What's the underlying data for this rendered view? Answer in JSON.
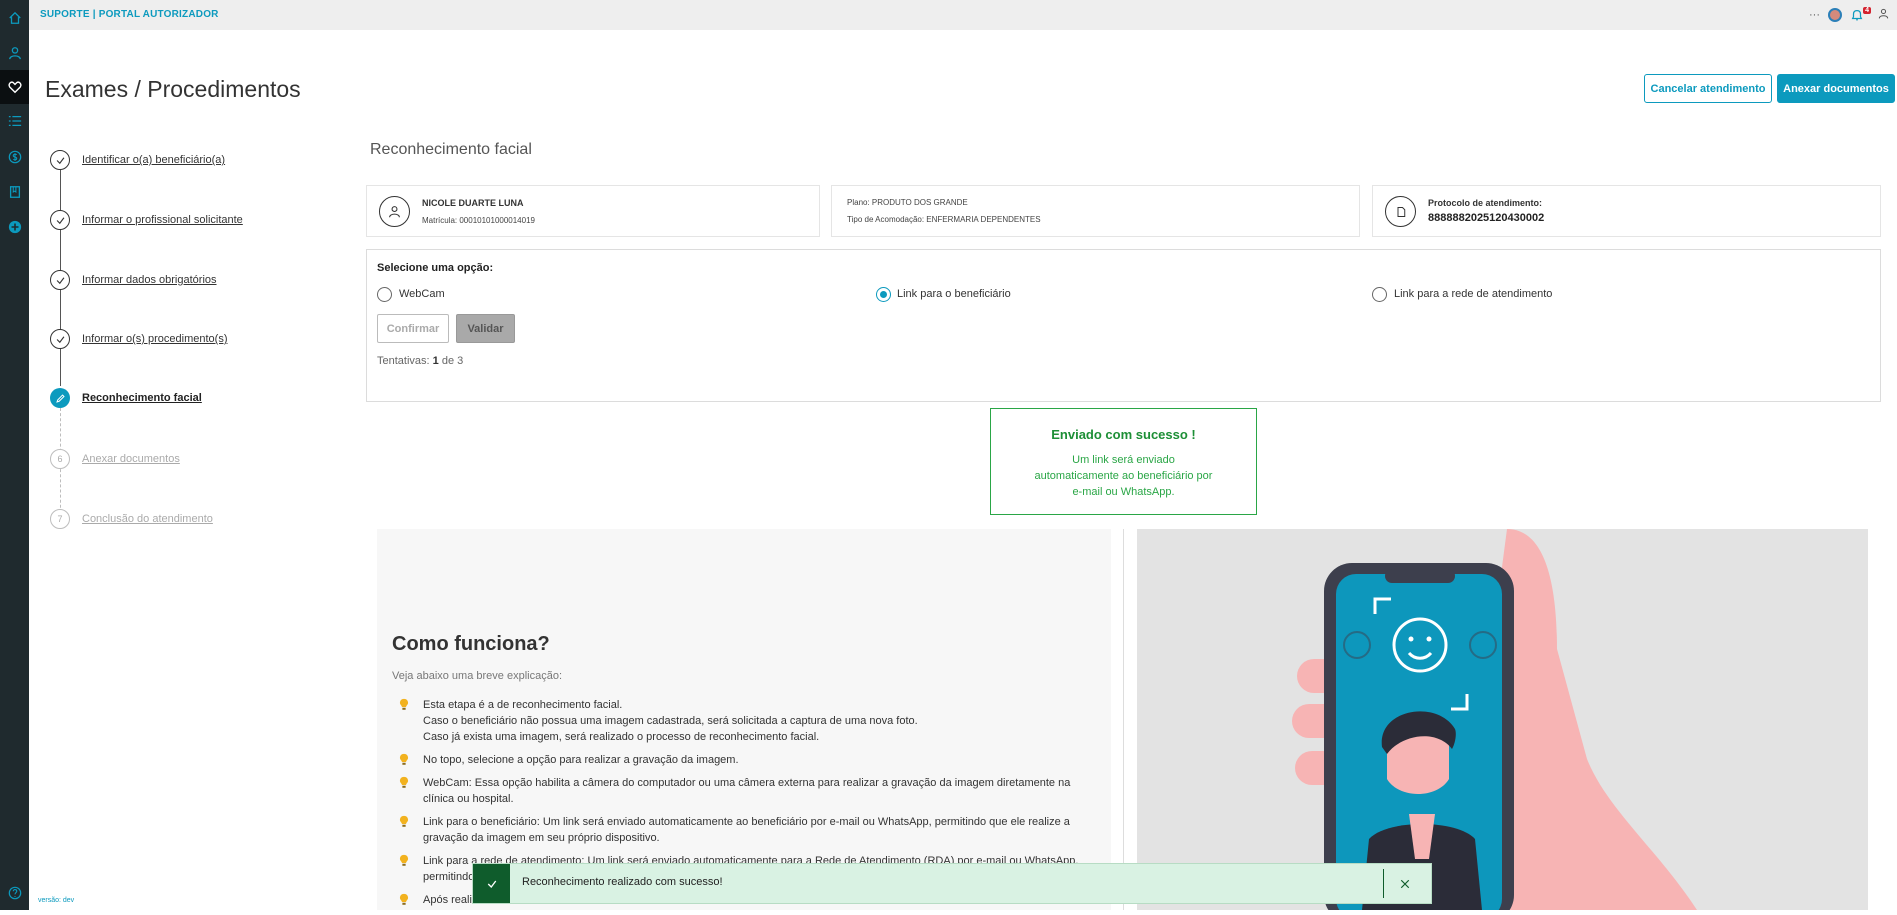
{
  "topbar": {
    "brand": "SUPORTE | PORTAL AUTORIZADOR",
    "more": "···",
    "notif_count": "4"
  },
  "page": {
    "title": "Exames / Procedimentos",
    "version": "versão: dev"
  },
  "buttons": {
    "cancel": "Cancelar atendimento",
    "attach": "Anexar documentos"
  },
  "steps": [
    {
      "label": "Identificar o(a) beneficiário(a)",
      "state": "done"
    },
    {
      "label": "Informar o profissional solicitante",
      "state": "done"
    },
    {
      "label": "Informar dados obrigatórios",
      "state": "done"
    },
    {
      "label": "Informar o(s) procedimento(s)",
      "state": "done"
    },
    {
      "label": "Reconhecimento facial",
      "state": "active"
    },
    {
      "label": "Anexar documentos",
      "state": "pending",
      "num": "6"
    },
    {
      "label": "Conclusão do atendimento",
      "state": "pending",
      "num": "7"
    }
  ],
  "section": {
    "title": "Reconhecimento facial"
  },
  "beneficiary": {
    "name": "NICOLE DUARTE LUNA",
    "matricula": "Matrícula: 00010101000014019"
  },
  "plan": {
    "plano": "Plano: PRODUTO DOS GRANDE",
    "acomodacao": "Tipo de Acomodação: ENFERMARIA DEPENDENTES"
  },
  "protocol": {
    "label": "Protocolo de atendimento:",
    "value": "8888882025120430002"
  },
  "options": {
    "heading": "Selecione uma opção:",
    "webcam": "WebCam",
    "link_benef": "Link para o beneficiário",
    "link_rede": "Link para a rede de atendimento",
    "confirm": "Confirmar",
    "validate": "Validar",
    "attempts_label": "Tentativas:",
    "attempts_current": "1",
    "attempts_total": "de 3"
  },
  "success": {
    "title": "Enviado com sucesso !",
    "message": "Um link será enviado automaticamente ao beneficiário por e-mail ou WhatsApp."
  },
  "how": {
    "title": "Como funciona?",
    "subtitle": "Veja abaixo uma breve explicação:",
    "items": [
      "Esta etapa é a de reconhecimento facial.",
      "Caso o beneficiário não possua uma imagem cadastrada, será solicitada a captura de uma nova foto.",
      "Caso já exista uma imagem, será realizado o processo de reconhecimento facial.",
      "No topo, selecione a opção para realizar a gravação da imagem.",
      "WebCam: Essa opção habilita a câmera do computador ou uma câmera externa para realizar a gravação da imagem diretamente na clínica ou hospital.",
      "Link para o beneficiário: Um link será enviado automaticamente ao beneficiário por e-mail ou WhatsApp, permitindo que ele realize a gravação da imagem em seu próprio dispositivo.",
      "Link para a rede de atendimento: Um link será enviado automaticamente para a Rede de Atendimento (RDA) por e-mail ou WhatsApp, permitindo",
      "Após realiz"
    ]
  },
  "snackbar": {
    "message": "Reconhecimento realizado com sucesso!"
  },
  "colors": {
    "primary": "#0c9abe",
    "success": "#2aa646",
    "sidebar": "#1f2a2e"
  }
}
